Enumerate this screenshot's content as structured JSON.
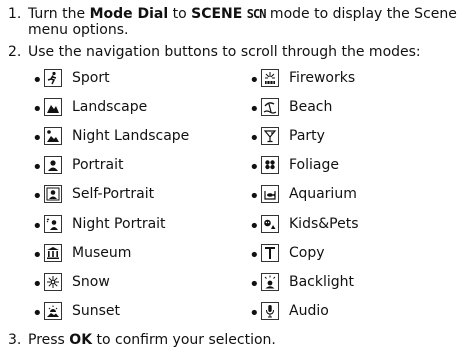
{
  "step1": {
    "num": "1.",
    "pre": "Turn the ",
    "dial": "Mode Dial",
    "mid": " to ",
    "scene": "SCENE",
    "scn": "SCN",
    "post": " mode to display the Scene menu options."
  },
  "step2": {
    "num": "2.",
    "text": "Use the navigation buttons to scroll through the modes:"
  },
  "bullet": "•",
  "modes_left": [
    {
      "label": "Sport",
      "icon": "sport-icon"
    },
    {
      "label": "Landscape",
      "icon": "landscape-icon"
    },
    {
      "label": "Night Landscape",
      "icon": "night-landscape-icon"
    },
    {
      "label": "Portrait",
      "icon": "portrait-icon"
    },
    {
      "label": "Self-Portrait",
      "icon": "self-portrait-icon"
    },
    {
      "label": "Night Portrait",
      "icon": "night-portrait-icon"
    },
    {
      "label": "Museum",
      "icon": "museum-icon"
    },
    {
      "label": "Snow",
      "icon": "snow-icon"
    },
    {
      "label": "Sunset",
      "icon": "sunset-icon"
    }
  ],
  "modes_right": [
    {
      "label": "Fireworks",
      "icon": "fireworks-icon"
    },
    {
      "label": "Beach",
      "icon": "beach-icon"
    },
    {
      "label": "Party",
      "icon": "party-icon"
    },
    {
      "label": "Foliage",
      "icon": "foliage-icon"
    },
    {
      "label": "Aquarium",
      "icon": "aquarium-icon"
    },
    {
      "label": "Kids&Pets",
      "icon": "kids-pets-icon"
    },
    {
      "label": "Copy",
      "icon": "copy-icon"
    },
    {
      "label": "Backlight",
      "icon": "backlight-icon"
    },
    {
      "label": "Audio",
      "icon": "audio-icon"
    }
  ],
  "step3": {
    "num": "3.",
    "pre": "Press ",
    "ok": "OK",
    "post": " to confirm your selection."
  }
}
